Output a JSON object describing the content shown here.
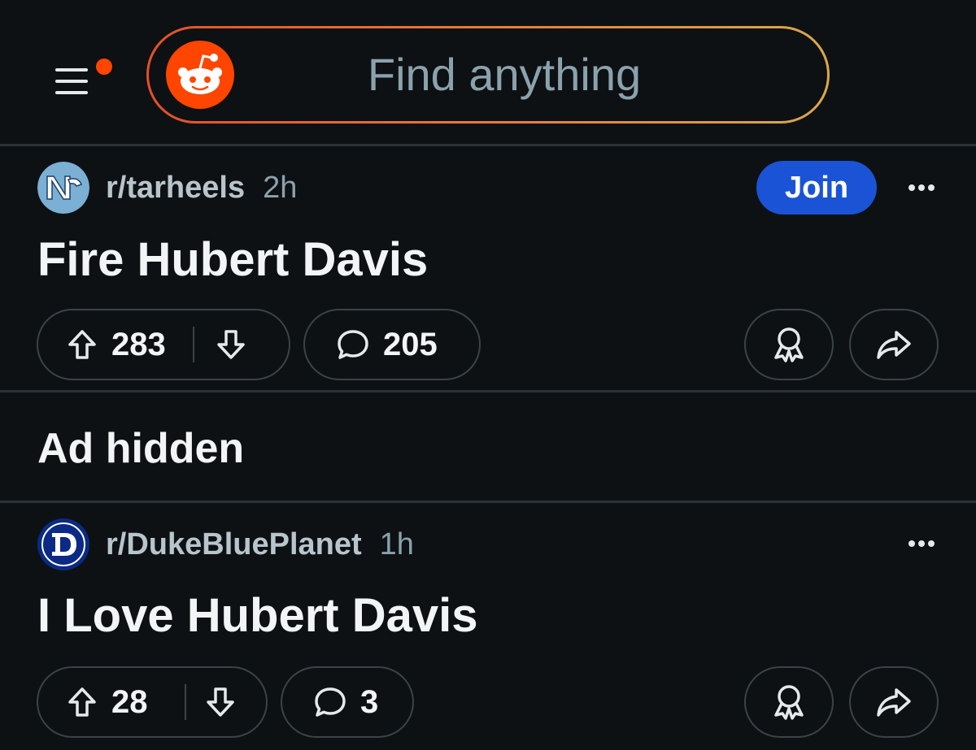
{
  "header": {
    "search_placeholder": "Find anything",
    "accent_color": "#e2502a",
    "notification_dot_color": "#ff4500"
  },
  "posts": [
    {
      "subreddit": "r/tarheels",
      "time": "2h",
      "join_label": "Join",
      "title": "Fire Hubert Davis",
      "upvotes": "283",
      "comments": "205",
      "avatar_icon": "unc-logo-icon"
    },
    {
      "subreddit": "r/DukeBluePlanet",
      "time": "1h",
      "title": "I Love Hubert Davis",
      "upvotes": "28",
      "comments": "3",
      "avatar_icon": "duke-logo-icon"
    }
  ],
  "ad": {
    "label": "Ad hidden"
  },
  "colors": {
    "background": "#0e1113",
    "join_button": "#1a53d6",
    "border": "#3a4448"
  }
}
